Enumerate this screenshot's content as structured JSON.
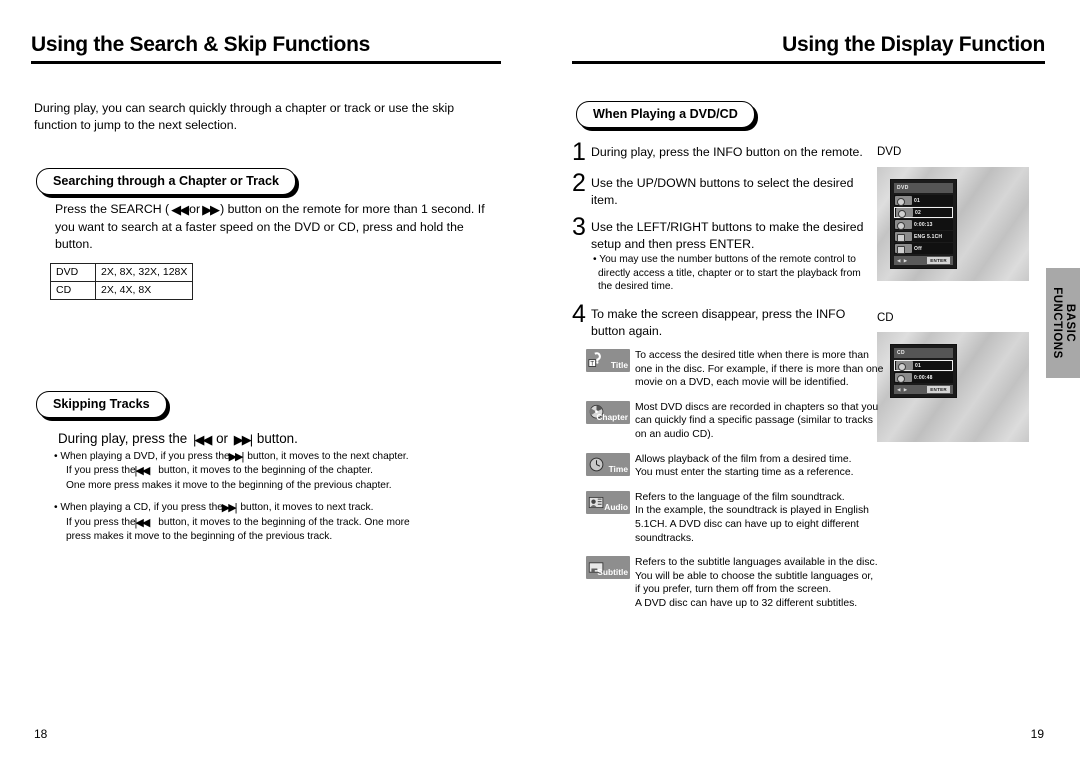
{
  "left_page": {
    "header": "Using the Search & Skip Functions",
    "intro": "During play, you can search quickly through a chapter or track or use the skip function to jump to the next selection.",
    "section1": {
      "pill": "Searching through a Chapter or Track",
      "line1_a": "Press the SEARCH (",
      "line1_rew": "◀◀",
      "line1_or": "or",
      "line1_ff": "▶▶",
      "line1_b": ") button on the remote for more than 1 second.",
      "line2": "If you want to search at a faster speed on the DVD or CD, press and hold the",
      "line3": "button.",
      "table": {
        "rows": [
          {
            "label": "DVD",
            "speeds": "2X, 8X, 32X, 128X"
          },
          {
            "label": "CD",
            "speeds": "2X, 4X, 8X"
          }
        ]
      }
    },
    "section2": {
      "pill": "Skipping Tracks",
      "lead_a": "During play, press the",
      "lead_prev": "|◀◀",
      "lead_or": "or",
      "lead_next": "▶▶|",
      "lead_b": "button.",
      "bullets": [
        {
          "l1_a": "• When playing a DVD, if you press the",
          "l1_icon": "▶▶|",
          "l1_b": "button, it moves to the next chapter.",
          "l2_a": "If you press the",
          "l2_icon": "|◀◀",
          "l2_b": "button, it moves to the beginning of the chapter.",
          "l3": "One more press makes it move to the beginning of the previous chapter."
        },
        {
          "l1_a": "• When playing a CD, if you press the",
          "l1_icon": "▶▶|",
          "l1_b": "button, it moves to next track.",
          "l2_a": "If you press the",
          "l2_icon": "|◀◀",
          "l2_b": "button, it moves to the beginning of the track. One more",
          "l3": "press makes it move to the beginning of the previous track."
        }
      ]
    },
    "page_number": "18"
  },
  "right_page": {
    "header": "Using the Display Function",
    "pill": "When Playing a DVD/CD",
    "steps": [
      {
        "num": "1",
        "text": "During play, press the INFO button on the remote."
      },
      {
        "num": "2",
        "text": "Use the UP/DOWN buttons to select the desired item."
      },
      {
        "num": "3",
        "text": "Use the LEFT/RIGHT buttons to make the desired setup and then press ENTER."
      },
      {
        "num": "4",
        "text": "To make the screen disappear, press the INFO button again."
      }
    ],
    "step3_note": [
      "• You may use the number buttons of the remote control to",
      "directly access a title, chapter or to start the playback from",
      "the desired time."
    ],
    "osd_dvd": {
      "caption": "DVD",
      "title": "DVD",
      "rows": [
        {
          "icon": "title-icon",
          "value": "01",
          "selected": false
        },
        {
          "icon": "chapter-icon",
          "value": "02",
          "selected": true
        },
        {
          "icon": "time-icon",
          "value": "0:00:13",
          "selected": false
        },
        {
          "icon": "audio-icon",
          "value": "ENG 5.1CH",
          "selected": false
        },
        {
          "icon": "subtitle-icon",
          "value": "Off",
          "selected": false
        }
      ],
      "arrows": "◀ ▶",
      "enter": "ENTER"
    },
    "osd_cd": {
      "caption": "CD",
      "title": "CD",
      "rows": [
        {
          "icon": "track-icon",
          "value": "01",
          "selected": true
        },
        {
          "icon": "time-icon",
          "value": "0:00:48",
          "selected": false
        }
      ],
      "arrows": "◀ ▶",
      "enter": "ENTER"
    },
    "legend": [
      {
        "badge": "Title",
        "icon": "title-icon",
        "lines": [
          "To access the desired title when there is more than",
          "one in the disc. For example, if there is more than one",
          "movie on a DVD, each movie will be identified."
        ]
      },
      {
        "badge": "Chapter",
        "icon": "chapter-icon",
        "lines": [
          "Most DVD discs are recorded in chapters so that you",
          "can quickly find a specific passage (similar to tracks",
          "on an audio CD)."
        ]
      },
      {
        "badge": "Time",
        "icon": "time-icon",
        "lines": [
          "Allows playback of the film from a desired time.",
          "You must enter the starting time as a reference."
        ]
      },
      {
        "badge": "Audio",
        "icon": "audio-icon",
        "lines": [
          "Refers to the language of the film soundtrack.",
          "In the example, the soundtrack is played in English",
          "5.1CH. A DVD disc can have up to eight different",
          "soundtracks."
        ]
      },
      {
        "badge": "Subtitle",
        "icon": "subtitle-icon",
        "lines": [
          "Refers to the subtitle languages available in the disc.",
          "You will be able to choose the subtitle languages or,",
          "if you prefer, turn them off from the screen.",
          "A DVD disc can have up to 32 different subtitles."
        ]
      }
    ],
    "side_tab": {
      "line1": "BASIC",
      "line2": "FUNCTIONS"
    },
    "page_number": "19"
  },
  "colors": {
    "badge_gray": "#8e8e8e",
    "side_tab_gray": "#a8a8a8",
    "osd_dark": "#1b1b1b"
  }
}
